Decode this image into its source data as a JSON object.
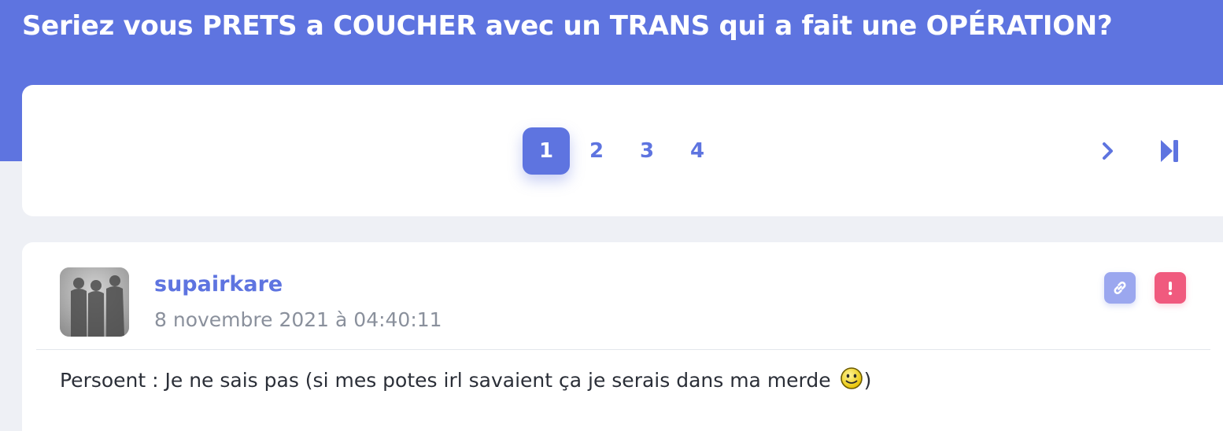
{
  "page": {
    "title": "Seriez vous PRETS a COUCHER avec un TRANS qui a fait une OPÉRATION?"
  },
  "pagination": {
    "pages": [
      "1",
      "2",
      "3",
      "4"
    ],
    "current": "1",
    "next_icon": "chevron-right-icon",
    "last_icon": "skip-to-end-icon"
  },
  "post": {
    "username": "supairkare",
    "date": "8 novembre 2021 à 04:40:11",
    "body_text": "Persoent : Je ne sais pas (si mes potes irl savaient ça je serais dans ma merde ",
    "body_end": ")",
    "smiley_icon": "smiley-icon",
    "actions": {
      "link_icon": "link-icon",
      "report_icon": "exclamation-icon"
    }
  },
  "colors": {
    "accent": "#5e74e0",
    "link_button": "#9ba7ef",
    "report_button": "#f05a7e",
    "meta_text": "#8a909c"
  }
}
